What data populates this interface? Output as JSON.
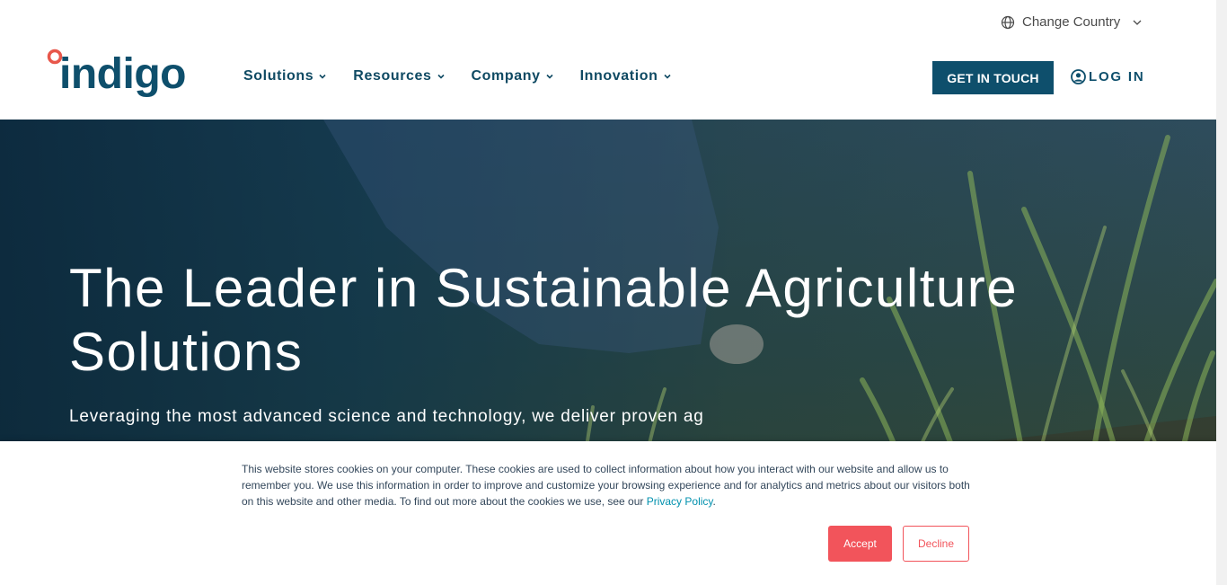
{
  "header": {
    "change_country": "Change Country",
    "logo_text": "indigo",
    "nav": [
      {
        "label": "Solutions"
      },
      {
        "label": "Resources"
      },
      {
        "label": "Company"
      },
      {
        "label": "Innovation"
      }
    ],
    "cta_label": "GET IN TOUCH",
    "login_label": "LOG IN"
  },
  "hero": {
    "title": "The Leader in Sustainable Agriculture Solutions",
    "subtitle": "Leveraging the most advanced science and technology, we deliver proven ag"
  },
  "cookie_banner": {
    "text": "This website stores cookies on your computer. These cookies are used to collect information about how you interact with our website and allow us to remember you. We use this information in order to improve and customize your browsing experience and for analytics and metrics about our visitors both on this website and other media. To find out more about the cookies we use, see our ",
    "link_text": "Privacy Policy",
    "text_end": ".",
    "accept_label": "Accept",
    "decline_label": "Decline"
  },
  "colors": {
    "brand_navy": "#0e4f6c",
    "nav_text": "#0f4a63",
    "logo_dot": "#e8574b",
    "cookie_accent": "#f2545b",
    "link": "#0091ae"
  },
  "icons": {
    "globe": "globe-icon",
    "chevron": "chevron-down-icon",
    "user": "user-circle-icon"
  }
}
